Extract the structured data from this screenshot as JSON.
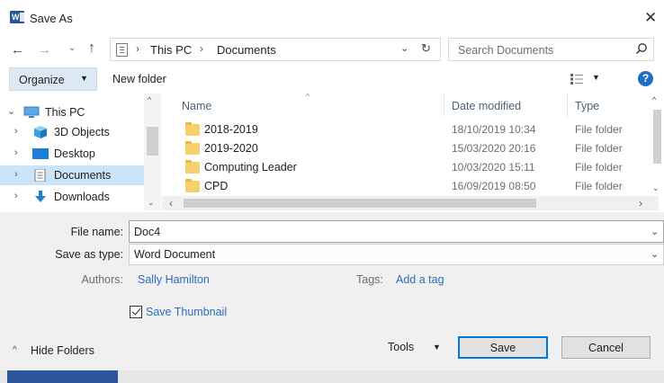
{
  "window": {
    "title": "Save As",
    "close_glyph": "✕",
    "app_icon": "word-icon",
    "app_icon_letter": "W"
  },
  "nav_buttons": {
    "back": "←",
    "forward": "→",
    "recent": "⌄",
    "up": "↑"
  },
  "address": {
    "segments": [
      "This PC",
      "Documents"
    ],
    "separator": "›",
    "dropdown": "⌄",
    "refresh": "↻"
  },
  "search": {
    "placeholder": "Search Documents"
  },
  "toolbar": {
    "organize": "Organize",
    "organize_caret": "▼",
    "new_folder": "New folder",
    "view_caret": "▼",
    "help": "?"
  },
  "nav_pane": {
    "items": [
      {
        "label": "This PC",
        "chevron": "⌄",
        "icon": "computer-icon"
      },
      {
        "label": "3D Objects",
        "chevron": "›",
        "icon": "cube-icon"
      },
      {
        "label": "Desktop",
        "chevron": "›",
        "icon": "desktop-icon"
      },
      {
        "label": "Documents",
        "chevron": "›",
        "icon": "document-icon",
        "selected": true
      },
      {
        "label": "Downloads",
        "chevron": "›",
        "icon": "download-icon"
      }
    ],
    "scroll_up": "^",
    "scroll_down": "⌄"
  },
  "file_list": {
    "columns": {
      "name": "Name",
      "date": "Date modified",
      "type": "Type",
      "sort_glyph": "^"
    },
    "rows": [
      {
        "name": "2018-2019",
        "date": "18/10/2019 10:34",
        "type": "File folder"
      },
      {
        "name": "2019-2020",
        "date": "15/03/2020 20:16",
        "type": "File folder"
      },
      {
        "name": "Computing Leader",
        "date": "10/03/2020 15:11",
        "type": "File folder"
      },
      {
        "name": "CPD",
        "date": "16/09/2019 08:50",
        "type": "File folder"
      }
    ],
    "v_up": "^",
    "v_down": "⌄",
    "h_left": "‹",
    "h_right": "›"
  },
  "form": {
    "file_name_label": "File name:",
    "file_name_value": "Doc4",
    "save_type_label": "Save as type:",
    "save_type_value": "Word Document",
    "dropdown_caret": "⌄",
    "authors_label": "Authors:",
    "authors_value": "Sally Hamilton",
    "tags_label": "Tags:",
    "tags_value": "Add a tag",
    "save_thumbnail_label": "Save Thumbnail",
    "save_thumbnail_checked": true
  },
  "footer": {
    "hide_folders_caret": "^",
    "hide_folders": "Hide Folders",
    "tools": "Tools",
    "tools_caret": "▼",
    "save": "Save",
    "cancel": "Cancel"
  },
  "colors": {
    "accent": "#0078d7",
    "selection": "#cce4f7",
    "link": "#2a6ebb",
    "word_blue": "#2b579a",
    "folder": "#f6d16b"
  }
}
